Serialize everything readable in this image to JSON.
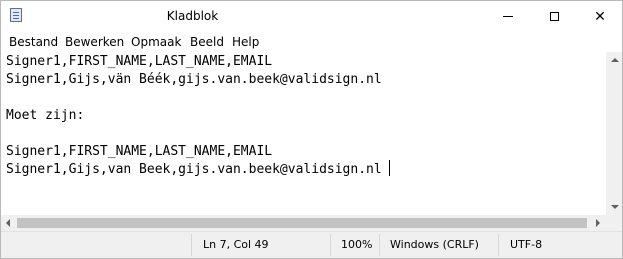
{
  "window": {
    "title": "Kladblok",
    "icon": "notepad-icon",
    "controls": [
      "minimize-icon",
      "maximize-icon",
      "close-icon"
    ],
    "close_glyph": "✕"
  },
  "menu": {
    "items": [
      {
        "label": "Bestand"
      },
      {
        "label": "Bewerken"
      },
      {
        "label": "Opmaak"
      },
      {
        "label": "Beeld"
      },
      {
        "label": "Help"
      }
    ]
  },
  "editor": {
    "lines": [
      "Signer1,FIRST_NAME,LAST_NAME,EMAIL",
      "Signer1,Gijs,vän Béék,gijs.van.beek@validsign.nl",
      "",
      "Moet zijn:",
      "",
      "Signer1,FIRST_NAME,LAST_NAME,EMAIL",
      "Signer1,Gijs,van Beek,gijs.van.beek@validsign.nl"
    ]
  },
  "status": {
    "position": "Ln 7, Col 49",
    "zoom": "100%",
    "line_endings": "Windows (CRLF)",
    "encoding": "UTF-8"
  }
}
